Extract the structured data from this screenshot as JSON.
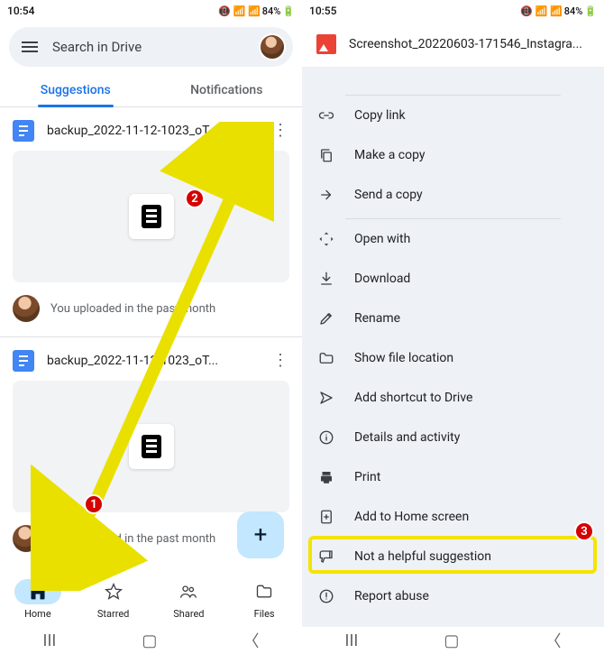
{
  "left": {
    "status": {
      "time": "10:54",
      "battery": "84%",
      "indicators": "◎"
    },
    "search_placeholder": "Search in Drive",
    "tabs": {
      "suggestions": "Suggestions",
      "notifications": "Notifications"
    },
    "files": [
      {
        "name": "backup_2022-11-12-1023_oT...",
        "caption": "You uploaded in the past month"
      },
      {
        "name": "backup_2022-11-12-1023_oT...",
        "caption": "You uploaded in the past month"
      }
    ],
    "fab_label": "+",
    "bottom_nav": {
      "home": "Home",
      "starred": "Starred",
      "shared": "Shared",
      "files": "Files"
    }
  },
  "right": {
    "status": {
      "time": "10:55",
      "battery": "84%"
    },
    "sheet_title": "Screenshot_20220603-171546_Instagra...",
    "menu": {
      "copy_link": "Copy link",
      "make_copy": "Make a copy",
      "send_copy": "Send a copy",
      "open_with": "Open with",
      "download": "Download",
      "rename": "Rename",
      "show_location": "Show file location",
      "add_shortcut": "Add shortcut to Drive",
      "details": "Details and activity",
      "print": "Print",
      "add_home": "Add to Home screen",
      "not_helpful": "Not a helpful suggestion",
      "report_abuse": "Report abuse"
    }
  },
  "annotations": {
    "b1": "1",
    "b2": "2",
    "b3": "3"
  }
}
